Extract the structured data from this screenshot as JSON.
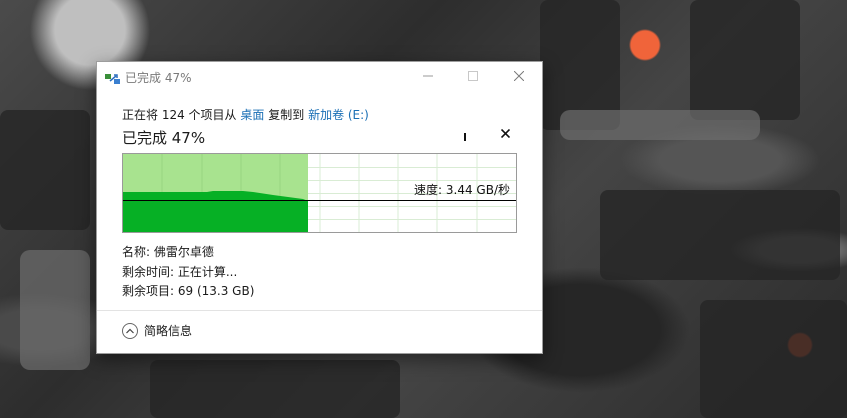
{
  "window": {
    "title": "已完成 47%",
    "icon": "copy-files-icon",
    "minimize_icon": "minimize-icon",
    "maximize_icon": "maximize-icon",
    "close_icon": "close-icon"
  },
  "copy_status": {
    "prefix": "正在将 124 个项目从",
    "source": "桌面",
    "middle": "复制到",
    "destination": "新加卷 (E:)"
  },
  "progress": {
    "heading": "已完成 47%",
    "percent": 47,
    "pause_icon": "pause-icon",
    "cancel_icon": "close-icon",
    "speed_text": "速度: 3.44 GB/秒"
  },
  "details": {
    "name": "名称: 佛雷尔卓德",
    "time_remaining": "剩余时间: 正在计算...",
    "items_remaining": "剩余项目: 69 (13.3 GB)"
  },
  "toggle": {
    "label": "简略信息",
    "icon": "chevron-up-icon"
  },
  "colors": {
    "fill_light": "#a8e38f",
    "fill_dark": "#06b025",
    "link": "#1a6fb5"
  }
}
